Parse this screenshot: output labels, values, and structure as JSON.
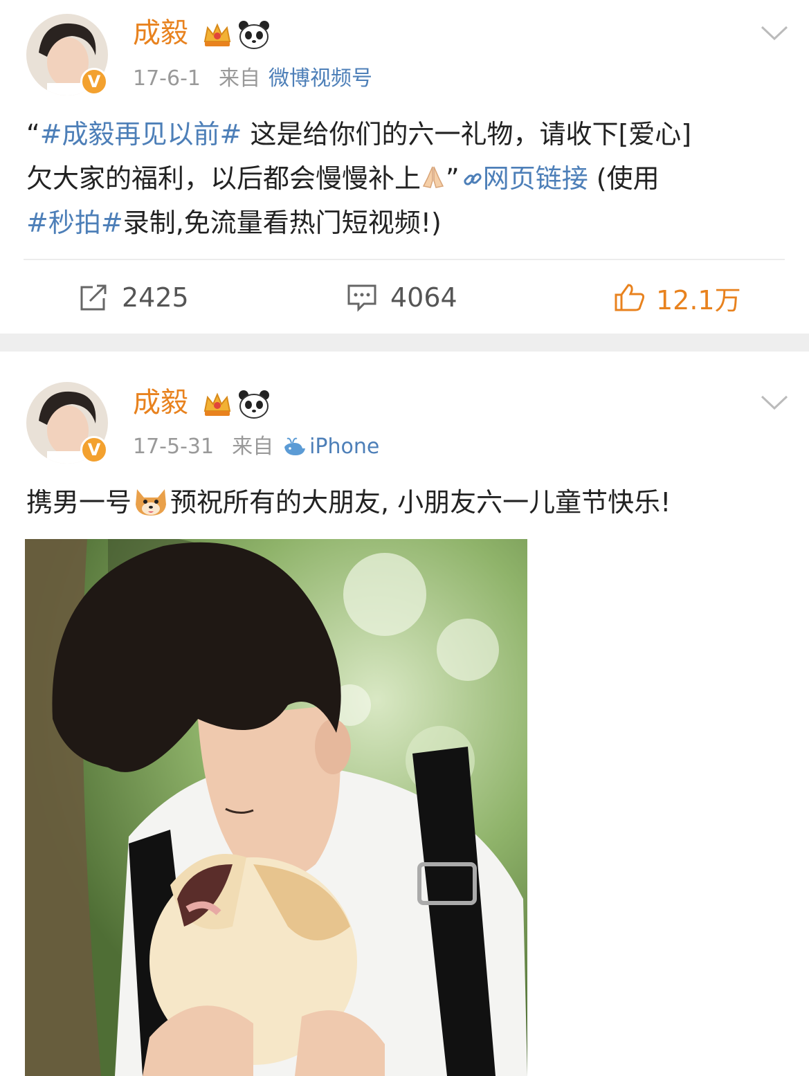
{
  "posts": [
    {
      "username": "成毅",
      "date": "17-6-1",
      "from_label": "来自",
      "source": "微博视频号",
      "text": {
        "open_quote": "“",
        "hashtag": "#成毅再见以前#",
        "line1_rest": " 这是给你们的六一礼物，请收下[爱心]",
        "line2": "欠大家的福利，以后都会慢慢补上",
        "close_quote": "”",
        "link_label": "网页链接",
        "line2_tail": " (使用",
        "hashtag2": "#秒拍#",
        "line3_rest": "录制,免流量看热门短视频!)"
      },
      "actions": {
        "repost": "2425",
        "comment": "4064",
        "like": "12.1万"
      }
    },
    {
      "username": "成毅",
      "date": "17-5-31",
      "from_label": "来自",
      "source": "iPhone",
      "text": {
        "part1": "携男一号",
        "part2": "预祝所有的大朋友, 小朋友六一儿童节快乐!"
      }
    }
  ],
  "colors": {
    "username": "#e8821e",
    "link": "#4d7fb8",
    "meta": "#999999",
    "like": "#e8821e",
    "separator": "#eeeeee"
  },
  "icons": [
    "avatar",
    "verified-badge-icon",
    "crown-icon",
    "panda-icon",
    "chevron-down-icon",
    "repost-icon",
    "comment-icon",
    "like-icon",
    "link-icon",
    "praying-hands-icon",
    "whale-icon",
    "shiba-emoji-icon"
  ]
}
